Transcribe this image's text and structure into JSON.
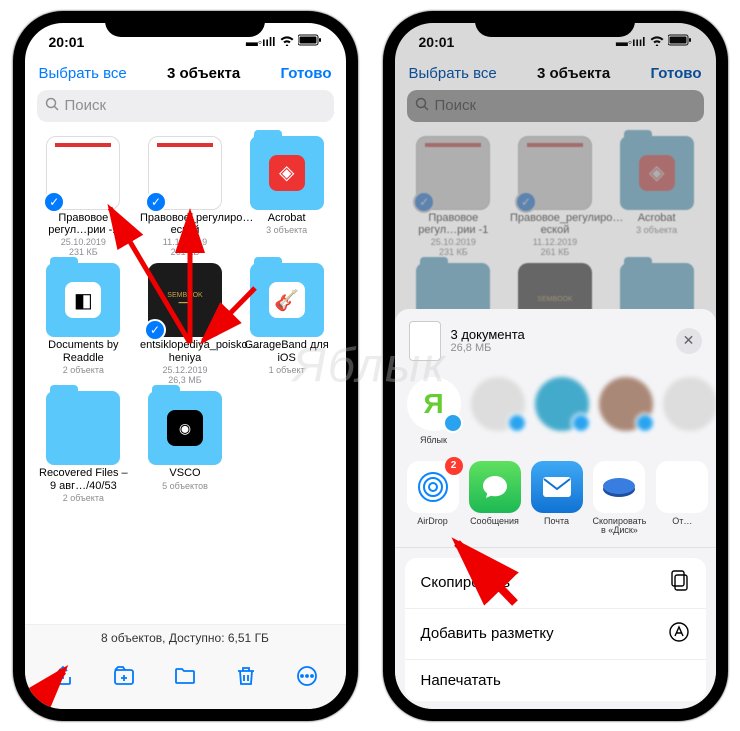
{
  "status": {
    "time": "20:01"
  },
  "nav": {
    "select_all": "Выбрать все",
    "title": "3 объекта",
    "done": "Готово"
  },
  "search": {
    "placeholder": "Поиск"
  },
  "items": [
    {
      "name": "Правовое регул…рии -1",
      "date": "25.10.2019",
      "size": "231 КБ"
    },
    {
      "name": "Правовое_регулиро…еской",
      "date": "11.12.2019",
      "size": "261 КБ"
    },
    {
      "name": "Acrobat",
      "meta": "3 объекта"
    },
    {
      "name": "Documents by Readdle",
      "meta": "2 объекта"
    },
    {
      "name": "entsiklopediya_poisko…heniya",
      "date": "25.12.2019",
      "size": "26,3 МБ"
    },
    {
      "name": "GarageBand для iOS",
      "meta": "1 объект"
    },
    {
      "name": "Recovered Files – 9 авг…/40/53",
      "meta": "2 объекта"
    },
    {
      "name": "VSCO",
      "meta": "5 объектов"
    }
  ],
  "footer": {
    "info": "8 объектов, Доступно: 6,51 ГБ"
  },
  "sheet": {
    "title": "3 документа",
    "subtitle": "26,8 МБ",
    "contacts": [
      {
        "name": "Яблык"
      },
      {
        "name": ""
      },
      {
        "name": ""
      },
      {
        "name": ""
      },
      {
        "name": ""
      }
    ],
    "apps": {
      "airdrop": "AirDrop",
      "airdrop_badge": "2",
      "messages": "Сообщения",
      "mail": "Почта",
      "disk": "Скопировать в «Диск»",
      "more": "От…"
    },
    "actions": {
      "copy": "Скопировать",
      "markup": "Добавить разметку",
      "print": "Напечатать"
    }
  },
  "watermark": "Яблык"
}
